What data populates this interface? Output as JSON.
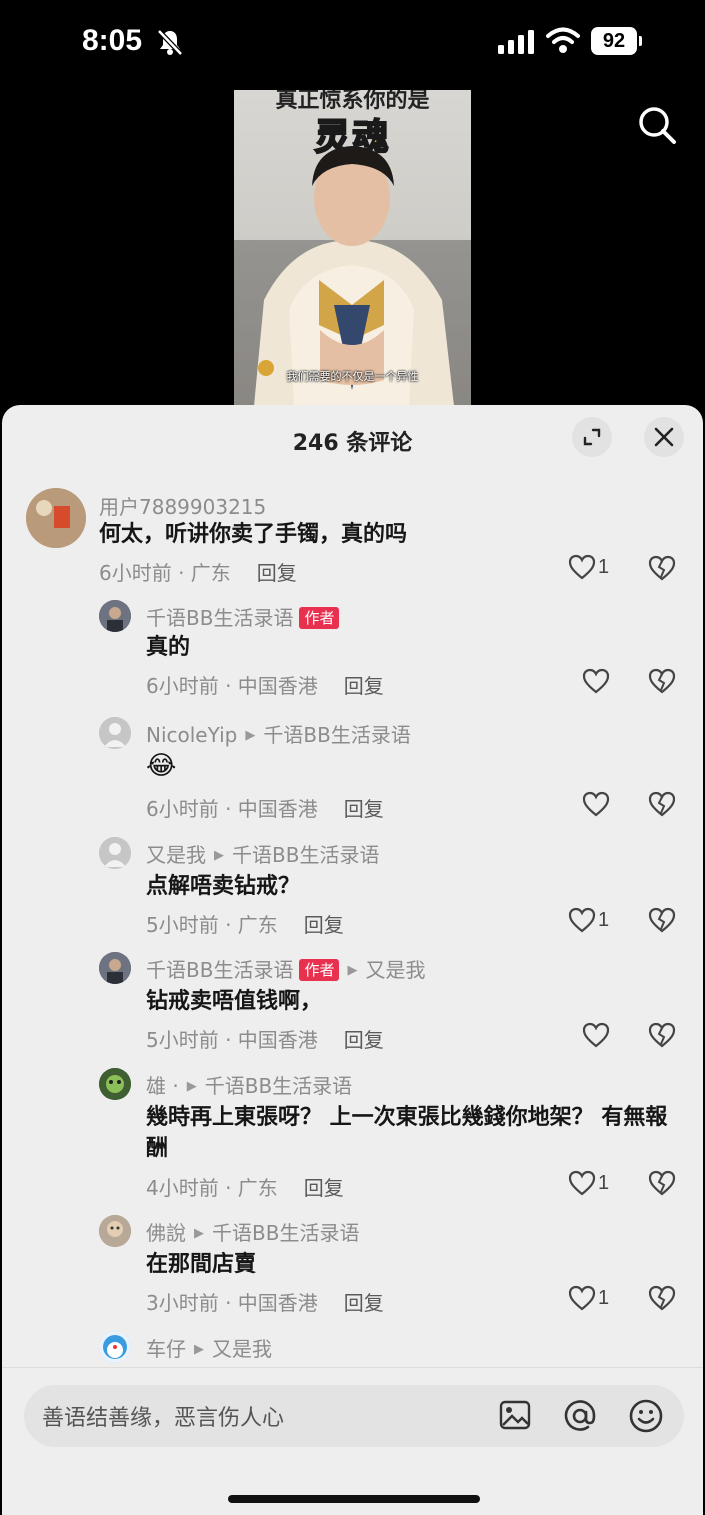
{
  "status": {
    "time": "8:05",
    "battery": "92"
  },
  "video": {
    "caption_top": "真正惊系你的是",
    "title": "灵魂",
    "subtitle": "我们需要的不仅是一个异性"
  },
  "sheet": {
    "title": "246 条评论",
    "author_tag": "作者"
  },
  "comments": [
    {
      "user": "用户7889903215",
      "text": "何太，听讲你卖了手镯，真的吗",
      "time": "6小时前 · 广东",
      "reply": "回复",
      "likes": "1"
    },
    {
      "user": "千语BB生活录语",
      "text": "真的",
      "time": "6小时前 · 中国香港",
      "reply": "回复",
      "likes": ""
    },
    {
      "user": "NicoleYip",
      "reply_to": "千语BB生活录语",
      "text": "😂",
      "time": "6小时前 · 中国香港",
      "reply": "回复",
      "likes": ""
    },
    {
      "user": "又是我",
      "reply_to": "千语BB生活录语",
      "text": "点解唔卖钻戒？",
      "time": "5小时前 · 广东",
      "reply": "回复",
      "likes": "1"
    },
    {
      "user": "千语BB生活录语",
      "reply_to": "又是我",
      "text": "钻戒卖唔值钱啊，",
      "time": "5小时前 · 中国香港",
      "reply": "回复",
      "likes": ""
    },
    {
      "user": "雄 ·",
      "reply_to": "千语BB生活录语",
      "text": "幾時再上東張呀？ 上一次東張比幾錢你地架？ 有無報酬",
      "time": "4小时前 · 广东",
      "reply": "回复",
      "likes": "1"
    },
    {
      "user": "佛說",
      "reply_to": "千语BB生活录语",
      "text": "在那間店賣",
      "time": "3小时前 · 中国香港",
      "reply": "回复",
      "likes": "1"
    },
    {
      "user": "车仔",
      "reply_to": "又是我"
    }
  ],
  "input": {
    "placeholder": "善语结善缘，恶言伤人心"
  },
  "colors": {
    "author_tag": "#e8304f",
    "sheet_bg": "#eeeeee"
  }
}
